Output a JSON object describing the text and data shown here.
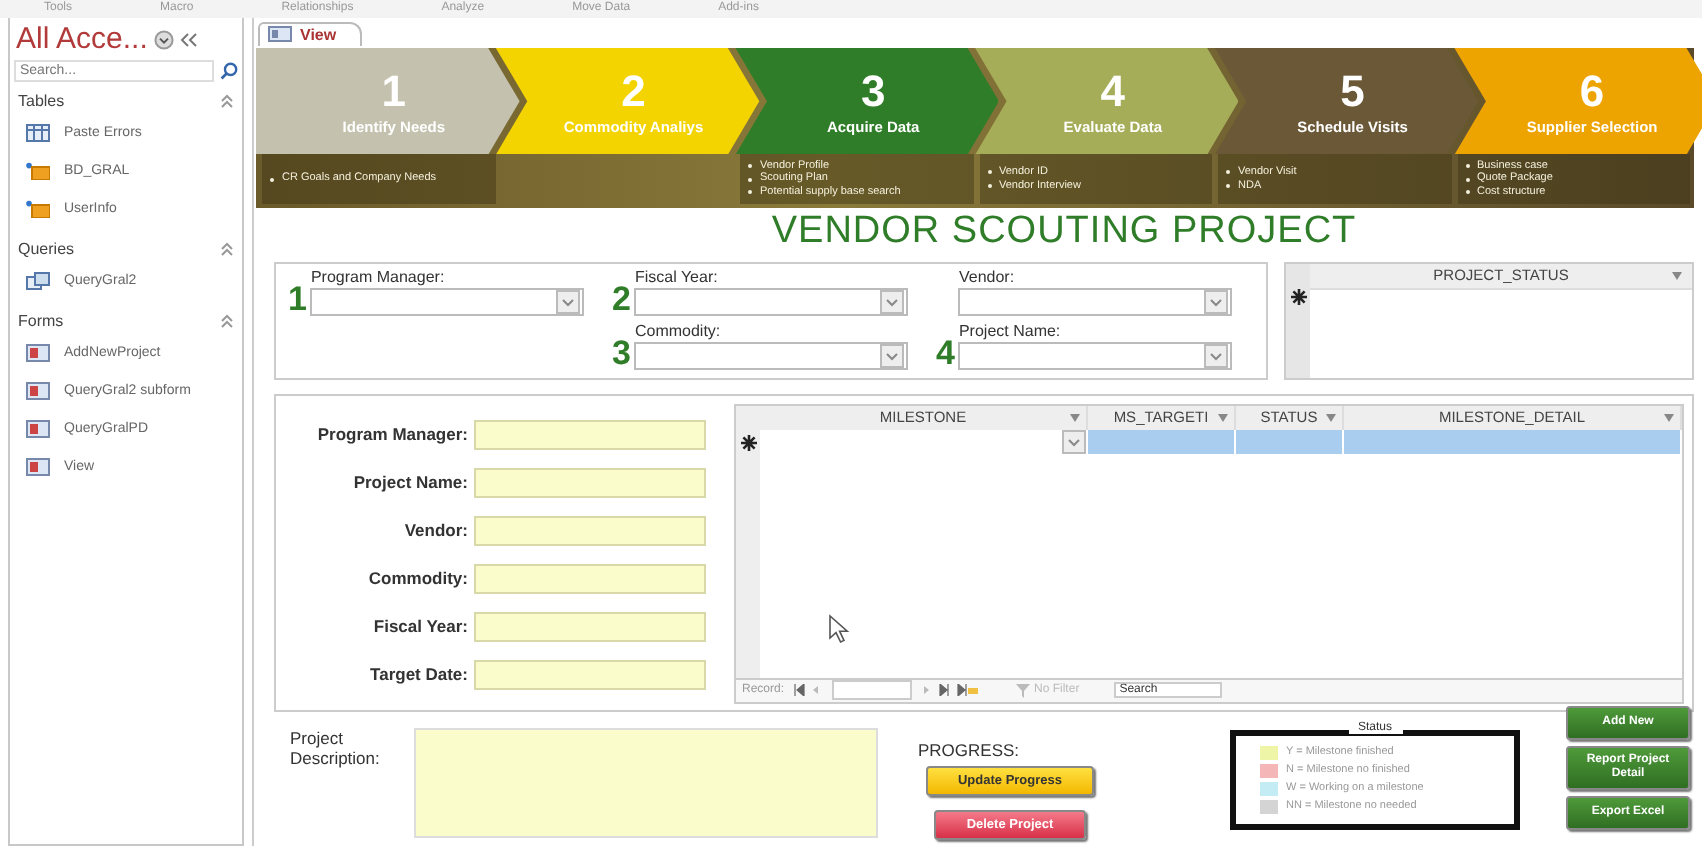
{
  "ribbon": [
    "Tools",
    "Macro",
    "Relationships",
    "Analyze",
    "Move Data",
    "Add-ins"
  ],
  "nav": {
    "title": "All Acce...",
    "search_placeholder": "Search...",
    "groups": [
      {
        "label": "Tables",
        "items": [
          {
            "label": "Paste Errors",
            "kind": "table"
          },
          {
            "label": "BD_GRAL",
            "kind": "linked"
          },
          {
            "label": "UserInfo",
            "kind": "linked"
          }
        ]
      },
      {
        "label": "Queries",
        "items": [
          {
            "label": "QueryGral2",
            "kind": "query"
          }
        ]
      },
      {
        "label": "Forms",
        "items": [
          {
            "label": "AddNewProject",
            "kind": "form"
          },
          {
            "label": "QueryGral2 subform",
            "kind": "form"
          },
          {
            "label": "QueryGralPD",
            "kind": "form"
          },
          {
            "label": "View",
            "kind": "form"
          }
        ]
      }
    ]
  },
  "document_tab": {
    "label": "View",
    "selected": true
  },
  "steps": [
    {
      "number": "1",
      "title": "Identify Needs",
      "color": "#c4c2ae",
      "bullets": [
        "CR Goals and Company Needs"
      ]
    },
    {
      "number": "2",
      "title": "Commodity Analiys",
      "color": "#f3d300"
    },
    {
      "number": "3",
      "title": "Acquire Data",
      "color": "#2f7d28",
      "bullets": [
        "Vendor Profile",
        "Scouting Plan",
        "Potential supply base search"
      ]
    },
    {
      "number": "4",
      "title": "Evaluate Data",
      "color": "#a6ad58",
      "bullets": [
        "Vendor ID",
        "Vendor Interview"
      ]
    },
    {
      "number": "5",
      "title": "Schedule Visits",
      "color": "#6a5837",
      "bullets": [
        "Vendor Visit",
        "NDA"
      ]
    },
    {
      "number": "6",
      "title": "Supplier Selection",
      "color": "#eea400",
      "bullets": [
        "Business case",
        "Quote Package",
        "Cost structure"
      ]
    }
  ],
  "form_title": "VENDOR SCOUTING PROJECT",
  "filter_columns": [
    [
      {
        "number": "1",
        "label": "Program Manager:"
      }
    ],
    [
      {
        "number": "2",
        "label": "Fiscal Year:"
      },
      {
        "number": "3",
        "label": "Commodity:"
      }
    ],
    [
      {
        "label": "Vendor:"
      },
      {
        "number": "4",
        "label": "Project Name:"
      }
    ]
  ],
  "project_status": {
    "column": "PROJECT_STATUS"
  },
  "details": [
    "Program Manager:",
    "Project Name:",
    "Vendor:",
    "Commodity:",
    "Fiscal Year:",
    "Target Date:"
  ],
  "milestones": {
    "columns": [
      "MILESTONE",
      "MS_TARGETI",
      "STATUS",
      "MILESTONE_DETAIL"
    ],
    "record_label": "Record:",
    "filter": "No Filter",
    "search": "Search"
  },
  "description_label": "Project Description:",
  "progress": {
    "label": "PROGRESS:",
    "buttons": [
      {
        "label": "Update Progress",
        "kind": "update"
      },
      {
        "label": "Delete Project",
        "kind": "delete"
      }
    ]
  },
  "legend": {
    "title": "Status",
    "items": [
      {
        "label": "Y = Milestone finished",
        "color": "#eef5a6"
      },
      {
        "label": "N = Milestone no finished",
        "color": "#f4b6b6"
      },
      {
        "label": "W = Working on a milestone",
        "color": "#c4ecf4"
      },
      {
        "label": "NN = Milestone no needed",
        "color": "#d4d4d4"
      }
    ]
  },
  "actions": [
    "Add New",
    "Report Project Detail",
    "Export Excel"
  ]
}
